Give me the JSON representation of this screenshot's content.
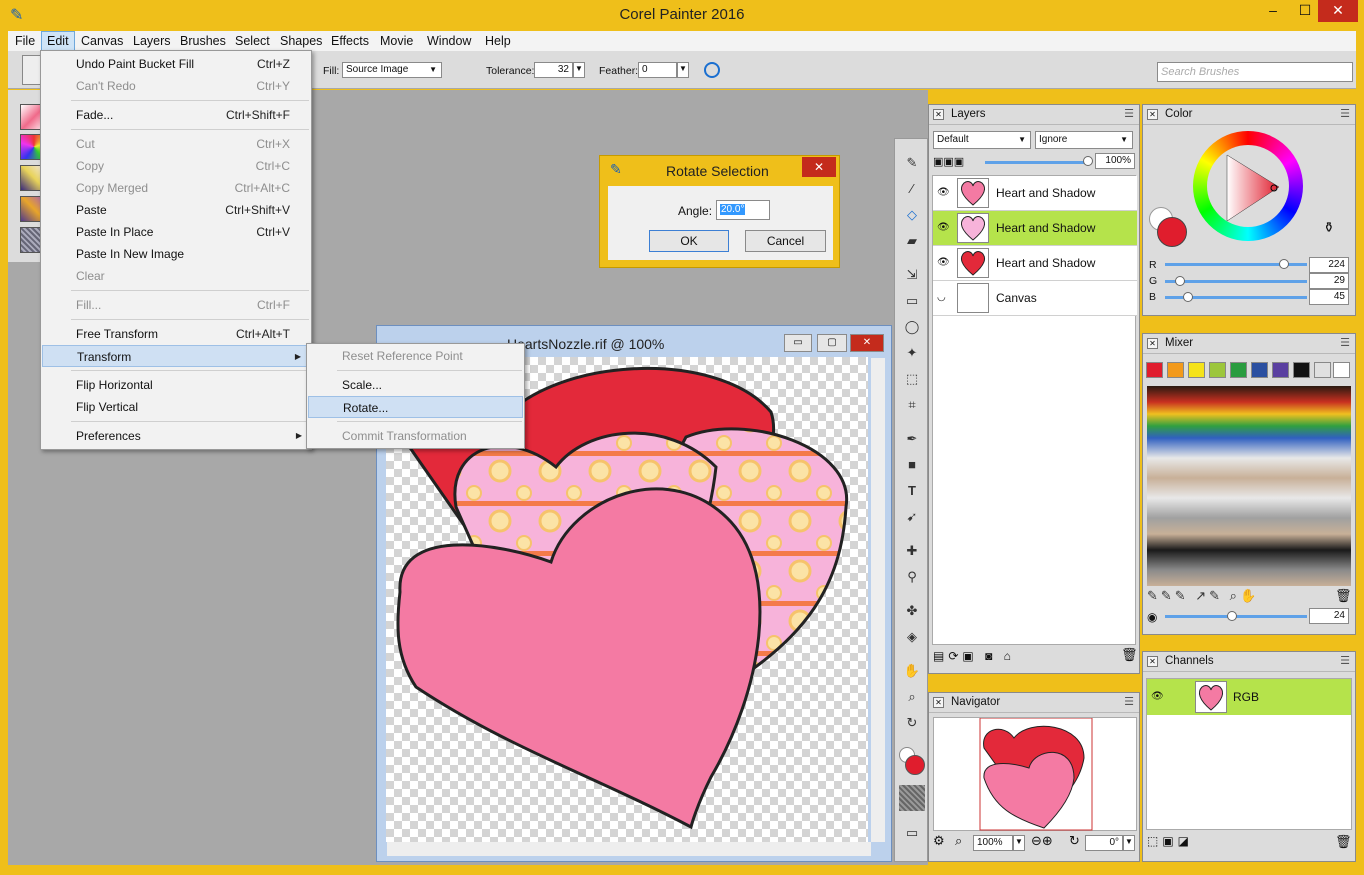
{
  "app": {
    "title": "Corel Painter 2016",
    "min": "–",
    "max": "☐",
    "close": "✕"
  },
  "menubar": [
    "File",
    "Edit",
    "Canvas",
    "Layers",
    "Brushes",
    "Select",
    "Shapes",
    "Effects",
    "Movie",
    "Window",
    "Help"
  ],
  "propbar": {
    "fill_label": "Fill:",
    "fill_value": "Source Image",
    "tolerance_label": "Tolerance:",
    "tolerance_value": "32",
    "feather_label": "Feather:",
    "feather_value": "0",
    "search_placeholder": "Search Brushes"
  },
  "edit_menu": {
    "undo": {
      "label": "Undo Paint Bucket Fill",
      "shortcut": "Ctrl+Z"
    },
    "redo": {
      "label": "Can't Redo",
      "shortcut": "Ctrl+Y"
    },
    "fade": {
      "label": "Fade...",
      "shortcut": "Ctrl+Shift+F"
    },
    "cut": {
      "label": "Cut",
      "shortcut": "Ctrl+X"
    },
    "copy": {
      "label": "Copy",
      "shortcut": "Ctrl+C"
    },
    "copy_merged": {
      "label": "Copy Merged",
      "shortcut": "Ctrl+Alt+C"
    },
    "paste": {
      "label": "Paste",
      "shortcut": "Ctrl+Shift+V"
    },
    "paste_in_place": {
      "label": "Paste In Place",
      "shortcut": "Ctrl+V"
    },
    "paste_new": {
      "label": "Paste In New Image"
    },
    "clear": {
      "label": "Clear"
    },
    "fill": {
      "label": "Fill...",
      "shortcut": "Ctrl+F"
    },
    "free_transform": {
      "label": "Free Transform",
      "shortcut": "Ctrl+Alt+T"
    },
    "transform": {
      "label": "Transform",
      "arrow": "▶"
    },
    "flip_h": {
      "label": "Flip Horizontal"
    },
    "flip_v": {
      "label": "Flip Vertical"
    },
    "preferences": {
      "label": "Preferences",
      "arrow": "▶"
    }
  },
  "transform_submenu": {
    "reset": "Reset Reference Point",
    "scale": "Scale...",
    "rotate": "Rotate...",
    "commit": "Commit Transformation"
  },
  "dialog": {
    "title": "Rotate Selection",
    "angle_label": "Angle:",
    "angle_value": "20.0°",
    "ok": "OK",
    "cancel": "Cancel",
    "close": "✕"
  },
  "document": {
    "title": "HeartsNozzle.rif @ 100%",
    "min": "▭",
    "max": "▢",
    "close": "✕"
  },
  "layers_panel": {
    "title": "Layers",
    "composite": "Default",
    "blend": "Ignore",
    "opacity": "100%",
    "rows": [
      {
        "name": "Heart and Shadow"
      },
      {
        "name": "Heart and Shadow"
      },
      {
        "name": "Heart and Shadow"
      },
      {
        "name": "Canvas"
      }
    ]
  },
  "color_panel": {
    "title": "Color",
    "r_label": "R",
    "g_label": "G",
    "b_label": "B",
    "r": "224",
    "g": "29",
    "b": "45",
    "main_color": "#e01d2d"
  },
  "mixer_panel": {
    "title": "Mixer",
    "size_value": "24",
    "swatches": [
      "#e01d2d",
      "#f39a1b",
      "#f5e31a",
      "#9cc63b",
      "#2a9c3f",
      "#2a4fa0",
      "#5a3fa0",
      "#111111",
      "#e0e0e0",
      "#ffffff"
    ]
  },
  "navigator_panel": {
    "title": "Navigator",
    "zoom": "100%",
    "rotation": "0°"
  },
  "channels_panel": {
    "title": "Channels",
    "row": "RGB"
  }
}
